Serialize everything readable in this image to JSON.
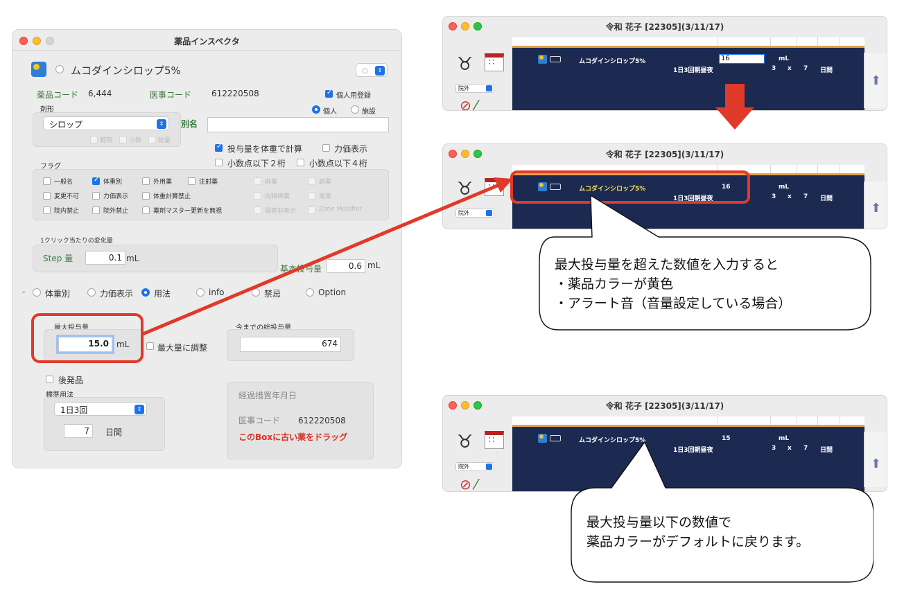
{
  "inspector": {
    "title": "薬品インスペクタ",
    "drug_name": "ムコダインシロップ5%",
    "drug_code_label": "薬品コード",
    "drug_code": "6,444",
    "iji_code_label": "医事コード",
    "iji_code": "612220508",
    "personal_register": "個人用登録",
    "personal": "個人",
    "facility": "施設",
    "dosage_form_label": "剤形",
    "dosage_form": "シロップ",
    "form_flags": [
      "錠剤",
      "小数",
      "総量"
    ],
    "alias_label": "別名",
    "calc_by_weight": "投与量を体重で計算",
    "show_potency_top": "力価表示",
    "decimal_2": "小数点以下２桁",
    "decimal_4": "小数点以下４桁",
    "flags_label": "フラグ",
    "flags": [
      "一般名",
      "体重別",
      "外用薬",
      "注射薬",
      "変更不可",
      "力価表示",
      "体重計算禁止",
      "院内禁止",
      "院外禁止",
      "薬剤マスター更新を無視"
    ],
    "flags_disabled": [
      "麻薬",
      "劇薬",
      "向精神薬",
      "毒薬",
      "検索非表示",
      "Zone Modifier"
    ],
    "per_click_label": "1クリック当たりの変化量",
    "step_label": "Step 量",
    "step_value": "0.1",
    "step_unit": "mL",
    "base_dose_label": "基本投与量",
    "base_dose_value": "0.6",
    "base_dose_unit": "mL",
    "tabs": [
      "体重別",
      "力価表示",
      "用法",
      "info",
      "禁忌",
      "Option"
    ],
    "max_dose_label": "最大投与量",
    "max_dose_value": "15.0",
    "max_dose_unit": "mL",
    "adjust_to_max": "最大量に調整",
    "total_dose_label": "今までの総投与量",
    "total_dose_value": "674",
    "generic": "後発品",
    "standard_usage_label": "標準用法",
    "standard_usage": "1日3回",
    "days_value": "7",
    "days_unit": "日間",
    "transition_label": "経過措置年月日",
    "transition_code_label": "医事コード",
    "transition_code": "612220508",
    "drag_hint": "このBoxに古い薬をドラッグ"
  },
  "records": {
    "title": "令和 花子 [22305](3/11/17)",
    "ward": "院外",
    "drug": "ムコダインシロップ5%",
    "dose_input": "16",
    "dose_high": "16",
    "dose_normal": "15",
    "unit": "mL",
    "usage": "1日3回朝昼夜",
    "qty": "3",
    "times": "x",
    "days": "7",
    "days_unit": "日間"
  },
  "callouts": {
    "warning_line1": "最大投与量を超えた数値を入力すると",
    "warning_line2": "・薬品カラーが黄色",
    "warning_line3": "・アラート音（音量設定している場合）",
    "normal_line1": "最大投与量以下の数値で",
    "normal_line2": "薬品カラーがデフォルトに戻ります。"
  },
  "colors": {
    "highlight_red": "#e03a2a",
    "warning_yellow": "#f3e25a",
    "record_bg": "#1c2a52",
    "accent_blue": "#1f73e8"
  }
}
